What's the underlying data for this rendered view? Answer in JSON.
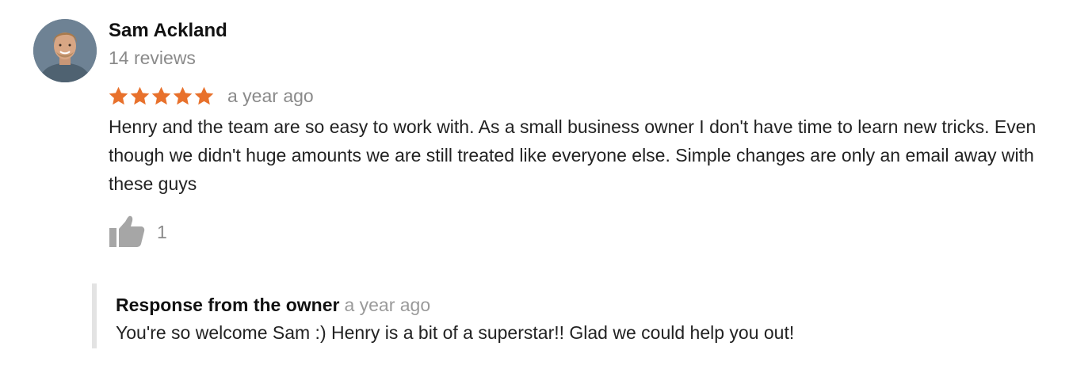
{
  "review": {
    "author_name": "Sam Ackland",
    "review_count": "14 reviews",
    "rating": 5,
    "rating_max": 5,
    "star_color": "#e8712c",
    "date": "a year ago",
    "text": "Henry and the team are so easy to work with. As a small business owner I don't have time to learn new tricks. Even though we didn't huge amounts we are still treated like everyone else. Simple changes are only an email away with these guys",
    "likes": "1",
    "icons": {
      "like": "thumbs-up-icon",
      "star": "star-icon"
    }
  },
  "owner_response": {
    "title": "Response from the owner",
    "date": "a year ago",
    "text": "You're so welcome Sam :) Henry is a bit of a superstar!! Glad we could help you out!"
  },
  "colors": {
    "muted_text": "#8a8a8a",
    "response_border": "#e3e3e3"
  }
}
